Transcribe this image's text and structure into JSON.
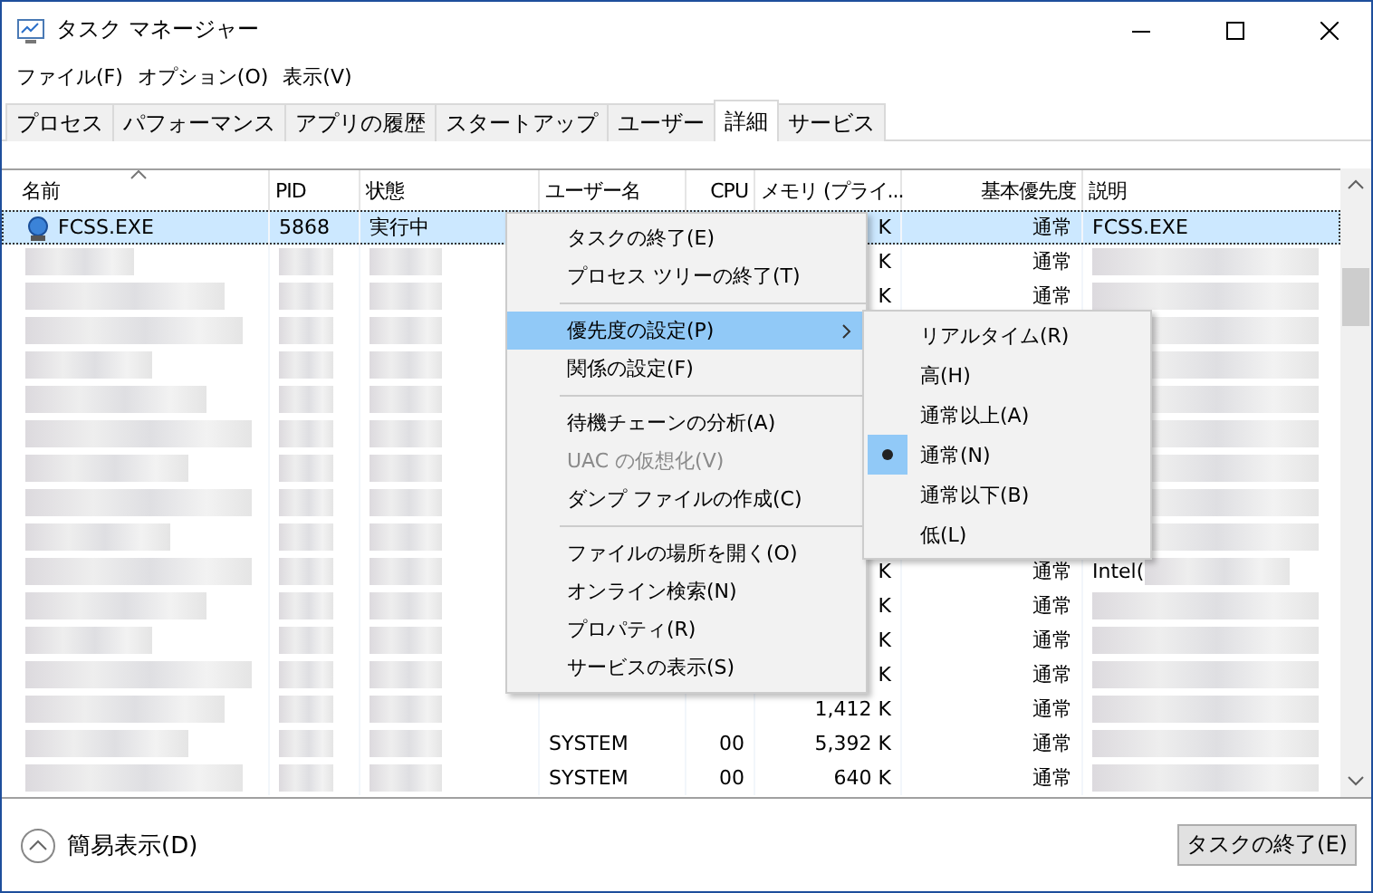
{
  "window": {
    "title": "タスク マネージャー"
  },
  "menubar": [
    "ファイル(F)",
    "オプション(O)",
    "表示(V)"
  ],
  "tabs": [
    {
      "label": "プロセス",
      "selected": false
    },
    {
      "label": "パフォーマンス",
      "selected": false
    },
    {
      "label": "アプリの履歴",
      "selected": false
    },
    {
      "label": "スタートアップ",
      "selected": false
    },
    {
      "label": "ユーザー",
      "selected": false
    },
    {
      "label": "詳細",
      "selected": true
    },
    {
      "label": "サービス",
      "selected": false
    }
  ],
  "table": {
    "columns": [
      "名前",
      "PID",
      "状態",
      "ユーザー名",
      "CPU",
      "メモリ (プライ...",
      "基本優先度",
      "説明"
    ],
    "rows": [
      {
        "selected": true,
        "name": "FCSS.EXE",
        "pid": "5868",
        "status": "実行中",
        "memory": "K",
        "priority": "通常",
        "description": "FCSS.EXE"
      },
      {
        "selected": false,
        "memory": "K",
        "priority": "通常"
      },
      {
        "selected": false,
        "memory": "K",
        "priority": "通常"
      },
      {
        "selected": false
      },
      {
        "selected": false
      },
      {
        "selected": false
      },
      {
        "selected": false
      },
      {
        "selected": false
      },
      {
        "selected": false
      },
      {
        "selected": false
      },
      {
        "selected": false,
        "memory": "K",
        "priority": "通常",
        "description": "Intel("
      },
      {
        "selected": false,
        "memory": "K",
        "priority": "通常"
      },
      {
        "selected": false,
        "memory": "K",
        "priority": "通常"
      },
      {
        "selected": false,
        "memory": "K",
        "priority": "通常"
      },
      {
        "selected": false,
        "memory": "1,412 K",
        "priority": "通常"
      },
      {
        "selected": false,
        "user": "SYSTEM",
        "cpu": "00",
        "memory": "5,392 K",
        "priority": "通常"
      },
      {
        "selected": false,
        "user": "SYSTEM",
        "cpu": "00",
        "memory": "640 K",
        "priority": "通常"
      }
    ]
  },
  "context_menu": {
    "items": [
      {
        "kind": "item",
        "label": "タスクの終了(E)",
        "highlighted": false,
        "disabled": false
      },
      {
        "kind": "item",
        "label": "プロセス ツリーの終了(T)",
        "highlighted": false,
        "disabled": false
      },
      {
        "kind": "separator"
      },
      {
        "kind": "submenu",
        "label": "優先度の設定(P)",
        "highlighted": true,
        "disabled": false
      },
      {
        "kind": "item",
        "label": "関係の設定(F)",
        "highlighted": false,
        "disabled": false
      },
      {
        "kind": "separator"
      },
      {
        "kind": "item",
        "label": "待機チェーンの分析(A)",
        "highlighted": false,
        "disabled": false
      },
      {
        "kind": "item",
        "label": "UAC の仮想化(V)",
        "highlighted": false,
        "disabled": true
      },
      {
        "kind": "item",
        "label": "ダンプ ファイルの作成(C)",
        "highlighted": false,
        "disabled": false
      },
      {
        "kind": "separator"
      },
      {
        "kind": "item",
        "label": "ファイルの場所を開く(O)",
        "highlighted": false,
        "disabled": false
      },
      {
        "kind": "item",
        "label": "オンライン検索(N)",
        "highlighted": false,
        "disabled": false
      },
      {
        "kind": "item",
        "label": "プロパティ(R)",
        "highlighted": false,
        "disabled": false
      },
      {
        "kind": "item",
        "label": "サービスの表示(S)",
        "highlighted": false,
        "disabled": false
      }
    ]
  },
  "priority_submenu": {
    "items": [
      {
        "label": "リアルタイム(R)",
        "selected": false
      },
      {
        "label": "高(H)",
        "selected": false
      },
      {
        "label": "通常以上(A)",
        "selected": false
      },
      {
        "label": "通常(N)",
        "selected": true
      },
      {
        "label": "通常以下(B)",
        "selected": false
      },
      {
        "label": "低(L)",
        "selected": false
      }
    ]
  },
  "footer": {
    "toggle_label": "簡易表示(D)",
    "end_task_button": "タスクの終了(E)"
  }
}
